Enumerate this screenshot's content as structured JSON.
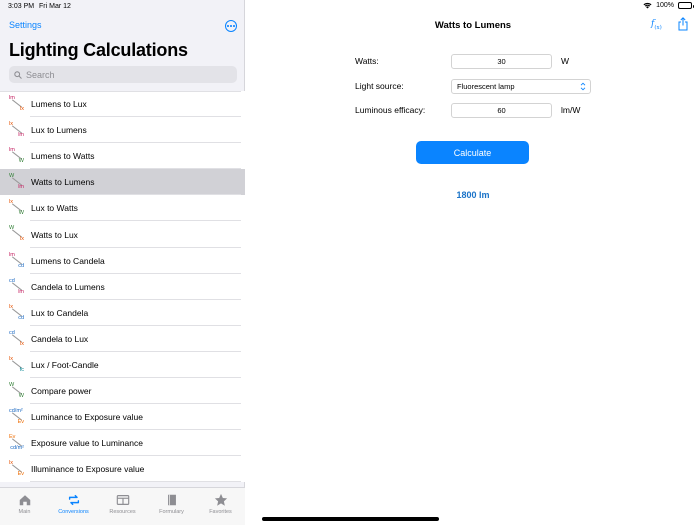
{
  "status": {
    "time": "3:03 PM",
    "date": "Fri Mar 12",
    "battery": "100%",
    "battery_level": 1.0
  },
  "sidebar": {
    "settings_label": "Settings",
    "title": "Lighting Calculations",
    "search_placeholder": "Search",
    "items": [
      {
        "label": "Lumens to Lux",
        "icon_top": "lm",
        "icon_bot": "lx",
        "top_color": "#c2185b",
        "bot_color": "#e65100"
      },
      {
        "label": "Lux to Lumens",
        "icon_top": "lx",
        "icon_bot": "lm",
        "top_color": "#e65100",
        "bot_color": "#c2185b"
      },
      {
        "label": "Lumens to Watts",
        "icon_top": "lm",
        "icon_bot": "W",
        "top_color": "#c2185b",
        "bot_color": "#2e7d32"
      },
      {
        "label": "Watts to Lumens",
        "icon_top": "W",
        "icon_bot": "lm",
        "top_color": "#2e7d32",
        "bot_color": "#c2185b"
      },
      {
        "label": "Lux to Watts",
        "icon_top": "lx",
        "icon_bot": "W",
        "top_color": "#e65100",
        "bot_color": "#2e7d32"
      },
      {
        "label": "Watts to Lux",
        "icon_top": "W",
        "icon_bot": "lx",
        "top_color": "#2e7d32",
        "bot_color": "#e65100"
      },
      {
        "label": "Lumens to Candela",
        "icon_top": "lm",
        "icon_bot": "cd",
        "top_color": "#c2185b",
        "bot_color": "#1565c0"
      },
      {
        "label": "Candela to Lumens",
        "icon_top": "cd",
        "icon_bot": "lm",
        "top_color": "#1565c0",
        "bot_color": "#c2185b"
      },
      {
        "label": "Lux to Candela",
        "icon_top": "lx",
        "icon_bot": "cd",
        "top_color": "#e65100",
        "bot_color": "#1565c0"
      },
      {
        "label": "Candela to Lux",
        "icon_top": "cd",
        "icon_bot": "lx",
        "top_color": "#1565c0",
        "bot_color": "#e65100"
      },
      {
        "label": "Lux / Foot-Candle",
        "icon_top": "lx",
        "icon_bot": "fc",
        "top_color": "#e65100",
        "bot_color": "#00838f"
      },
      {
        "label": "Compare power",
        "icon_top": "W",
        "icon_bot": "W",
        "top_color": "#2e7d32",
        "bot_color": "#2e7d32"
      },
      {
        "label": "Luminance to Exposure value",
        "icon_top": "cd/m²",
        "icon_bot": "Ev",
        "top_color": "#1565c0",
        "bot_color": "#ef6c00"
      },
      {
        "label": "Exposure value to Luminance",
        "icon_top": "Ev",
        "icon_bot": "cd/m²",
        "top_color": "#ef6c00",
        "bot_color": "#1565c0"
      },
      {
        "label": "Illuminance to Exposure value",
        "icon_top": "lx",
        "icon_bot": "Ev",
        "top_color": "#e65100",
        "bot_color": "#ef6c00"
      }
    ],
    "selected_index": 3
  },
  "tabs": [
    {
      "label": "Main",
      "icon": "home-icon"
    },
    {
      "label": "Conversions",
      "icon": "conversions-icon"
    },
    {
      "label": "Resources",
      "icon": "resources-icon"
    },
    {
      "label": "Formulary",
      "icon": "book-icon"
    },
    {
      "label": "Favorites",
      "icon": "star-icon"
    }
  ],
  "active_tab_index": 1,
  "main": {
    "title": "Watts to Lumens",
    "watts_label": "Watts:",
    "watts_value": "30",
    "watts_unit": "W",
    "source_label": "Light source:",
    "source_value": "Fluorescent lamp",
    "efficacy_label": "Luminous efficacy:",
    "efficacy_value": "60",
    "efficacy_unit": "lm/W",
    "calculate_label": "Calculate",
    "result": "1800 lm"
  },
  "colors": {
    "accent": "#0a84ff",
    "selected_row": "#d1d1d6",
    "result": "#1a73c8"
  }
}
